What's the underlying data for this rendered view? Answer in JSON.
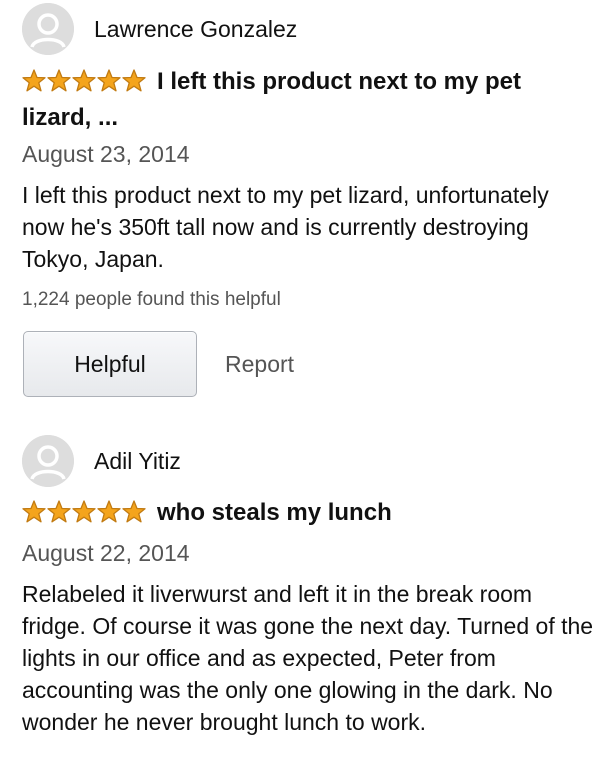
{
  "reviews": [
    {
      "reviewer_name": "Lawrence Gonzalez",
      "rating": 5,
      "headline": "I left this product next to my pet lizard, ...",
      "date": "August 23, 2014",
      "body": "I left this product next to my pet lizard, unfortunately now he's 350ft tall now and is currently destroying Tokyo, Japan.",
      "helpful_count_text": "1,224 people found this helpful",
      "helpful_button_label": "Helpful",
      "report_label": "Report"
    },
    {
      "reviewer_name": "Adil Yitiz",
      "rating": 5,
      "headline": "who steals my lunch",
      "date": "August 22, 2014",
      "body": "Relabeled it liverwurst and left it in the break room fridge. Of course it was gone the next day. Turned of the lights in our office and as expected, Peter from accounting was the only one glowing in the dark. No wonder he never brought lunch to work."
    }
  ],
  "colors": {
    "star_fill": "#f4a41c",
    "star_outline": "#c27b12",
    "avatar_bg": "#dddddd",
    "avatar_figure": "#ffffff",
    "muted_text": "#555555"
  },
  "icons": {
    "avatar": "person-silhouette-icon",
    "star": "star-icon"
  }
}
